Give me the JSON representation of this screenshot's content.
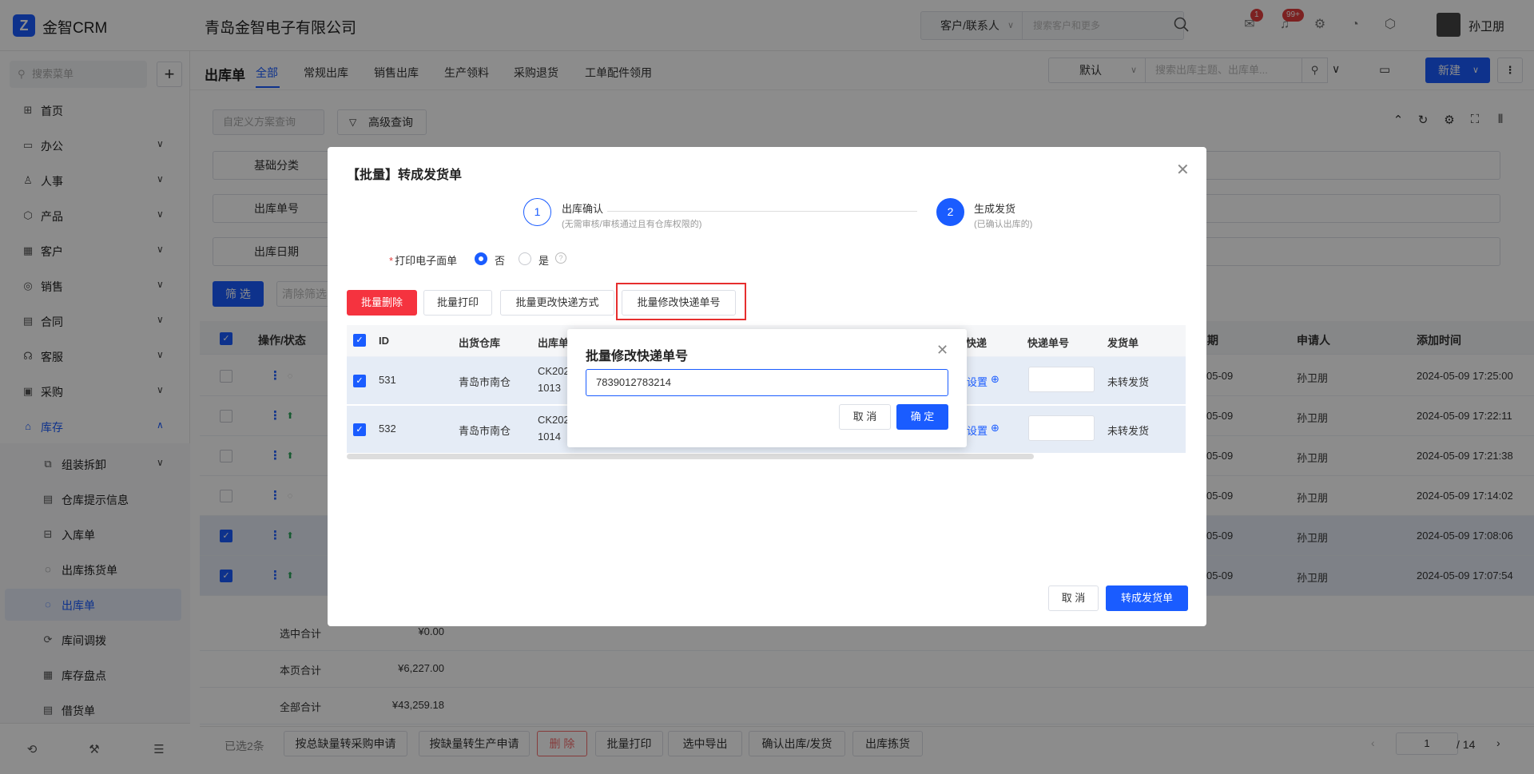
{
  "header": {
    "app_name": "金智CRM",
    "company": "青岛金智电子有限公司",
    "search_type": "客户/联系人",
    "search_placeholder": "搜索客户和更多",
    "notif_badge_1": "1",
    "notif_badge_2": "99+",
    "user_name": "孙卫朋"
  },
  "sidebar": {
    "search_placeholder": "搜索菜单",
    "items": [
      {
        "label": "首页",
        "icon": "home-icon"
      },
      {
        "label": "办公",
        "icon": "office-icon"
      },
      {
        "label": "人事",
        "icon": "people-icon"
      },
      {
        "label": "产品",
        "icon": "box-icon"
      },
      {
        "label": "客户",
        "icon": "chart-icon"
      },
      {
        "label": "销售",
        "icon": "sales-icon"
      },
      {
        "label": "合同",
        "icon": "contract-icon"
      },
      {
        "label": "客服",
        "icon": "headset-icon"
      },
      {
        "label": "采购",
        "icon": "bag-icon"
      },
      {
        "label": "库存",
        "icon": "warehouse-icon"
      }
    ],
    "subitems": [
      {
        "label": "组装拆卸"
      },
      {
        "label": "仓库提示信息"
      },
      {
        "label": "入库单"
      },
      {
        "label": "出库拣货单"
      },
      {
        "label": "出库单"
      },
      {
        "label": "库间调拨"
      },
      {
        "label": "库存盘点"
      },
      {
        "label": "借货单"
      }
    ]
  },
  "page": {
    "title": "出库单",
    "tabs": [
      "全部",
      "常规出库",
      "销售出库",
      "生产领料",
      "采购退货",
      "工单配件领用"
    ],
    "view_select": "默认",
    "list_search_placeholder": "搜索出库主题、出库单...",
    "new_label": "新建",
    "scheme_placeholder": "自定义方案查询",
    "adv_query": "高级查询",
    "filters": [
      "基础分类",
      "出库单号",
      "出库日期"
    ],
    "filter_btn": "筛 选",
    "clear_btn": "清除筛选"
  },
  "bg_table": {
    "headers": {
      "ops": "操作/状态",
      "date": "日期",
      "applicant": "申请人",
      "added": "添加时间"
    },
    "rows": [
      {
        "date": "05-09",
        "applicant": "孙卫朋",
        "added": "2024-05-09 17:25:00",
        "checked": false
      },
      {
        "date": "05-09",
        "applicant": "孙卫朋",
        "added": "2024-05-09 17:22:11",
        "checked": false
      },
      {
        "date": "05-09",
        "applicant": "孙卫朋",
        "added": "2024-05-09 17:21:38",
        "checked": false
      },
      {
        "date": "05-09",
        "applicant": "孙卫朋",
        "added": "2024-05-09 17:14:02",
        "checked": false
      },
      {
        "date": "05-09",
        "applicant": "孙卫朋",
        "added": "2024-05-09 17:08:06",
        "checked": true
      },
      {
        "date": "05-09",
        "applicant": "孙卫朋",
        "added": "2024-05-09 17:07:54",
        "checked": true
      }
    ],
    "summary": [
      {
        "label": "选中合计",
        "value": "¥0.00"
      },
      {
        "label": "本页合计",
        "value": "¥6,227.00"
      },
      {
        "label": "全部合计",
        "value": "¥43,259.18"
      }
    ]
  },
  "bottom_bar": {
    "selected": "已选2条",
    "buttons": [
      "按总缺量转采购申请",
      "按缺量转生产申请",
      "删 除",
      "批量打印",
      "选中导出",
      "确认出库/发货",
      "出库拣货"
    ],
    "page": "1",
    "total_pages": "/ 14"
  },
  "modal": {
    "title": "【批量】转成发货单",
    "step1": {
      "num": "1",
      "title": "出库确认",
      "desc": "(无需审核/审核通过且有仓库权限的)"
    },
    "step2": {
      "num": "2",
      "title": "生成发货",
      "desc": "(已确认出库的)"
    },
    "print_label": "打印电子面单",
    "opt_no": "否",
    "opt_yes": "是",
    "buttons": [
      "批量删除",
      "批量打印",
      "批量更改快递方式",
      "批量修改快递单号"
    ],
    "table_headers": {
      "id": "ID",
      "warehouse": "出货仓库",
      "out_no": "出库单",
      "express": "快递",
      "tracking": "快递单号",
      "ship": "发货单"
    },
    "rows": [
      {
        "id": "531",
        "warehouse": "青岛市南仓",
        "no_a": "CK202",
        "no_b": "1013",
        "express_link": "设置",
        "ship": "未转发货"
      },
      {
        "id": "532",
        "warehouse": "青岛市南仓",
        "no_a": "CK202",
        "no_b": "1014",
        "express_link": "设置",
        "ship": "未转发货"
      }
    ],
    "cancel": "取 消",
    "confirm": "转成发货单"
  },
  "popover": {
    "title": "批量修改快递单号",
    "value": "7839012783214",
    "cancel": "取 消",
    "ok": "确 定"
  }
}
